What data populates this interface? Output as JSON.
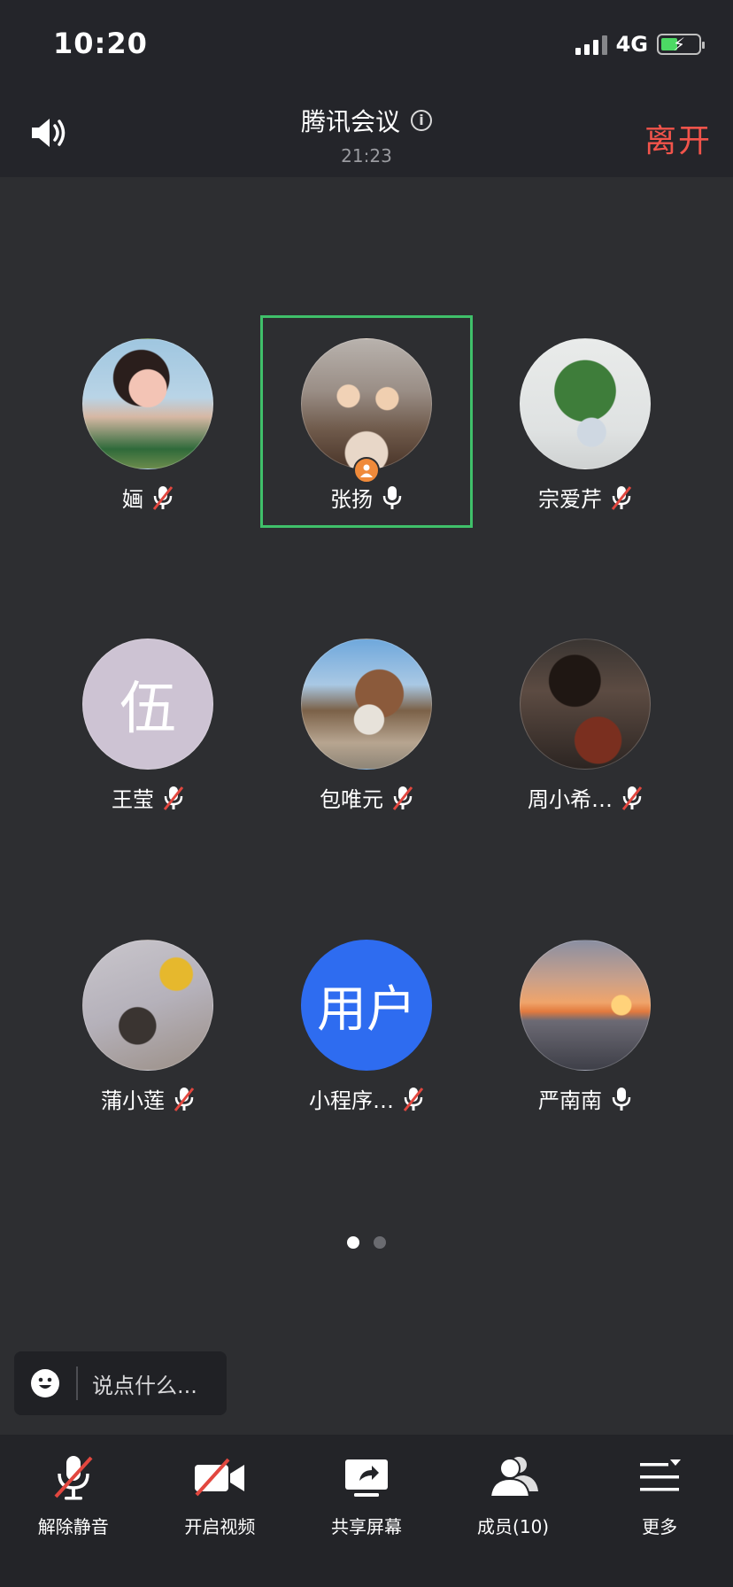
{
  "status": {
    "time": "10:20",
    "network": "4G"
  },
  "header": {
    "title": "腾讯会议",
    "timer": "21:23",
    "leave_label": "离开"
  },
  "participants": [
    {
      "name": "婳",
      "mic": "muted",
      "avatar": "photo"
    },
    {
      "name": "张扬",
      "mic": "on",
      "avatar": "photo",
      "speaking": true,
      "host": true
    },
    {
      "name": "宗爱芹",
      "mic": "muted",
      "avatar": "photo"
    },
    {
      "name": "王莹",
      "mic": "muted",
      "avatar": "letter",
      "avatar_text": "伍"
    },
    {
      "name": "包唯元",
      "mic": "muted",
      "avatar": "photo"
    },
    {
      "name": "周小希…",
      "mic": "muted",
      "avatar": "photo"
    },
    {
      "name": "蒲小莲",
      "mic": "muted",
      "avatar": "photo"
    },
    {
      "name": "小程序…",
      "mic": "muted",
      "avatar": "text",
      "avatar_text": "用户"
    },
    {
      "name": "严南南",
      "mic": "on",
      "avatar": "photo"
    }
  ],
  "pager": {
    "pages": 2,
    "current": 1
  },
  "chat": {
    "placeholder": "说点什么..."
  },
  "toolbar": {
    "unmute_label": "解除静音",
    "video_label": "开启视频",
    "share_label": "共享屏幕",
    "members_label": "成员(10)",
    "more_label": "更多"
  },
  "colors": {
    "leave": "#f2544b",
    "active_border": "#3fc06a",
    "host_badge": "#f08a3a",
    "user_avatar": "#2e6cf0",
    "muted_slash": "#e2473f"
  }
}
